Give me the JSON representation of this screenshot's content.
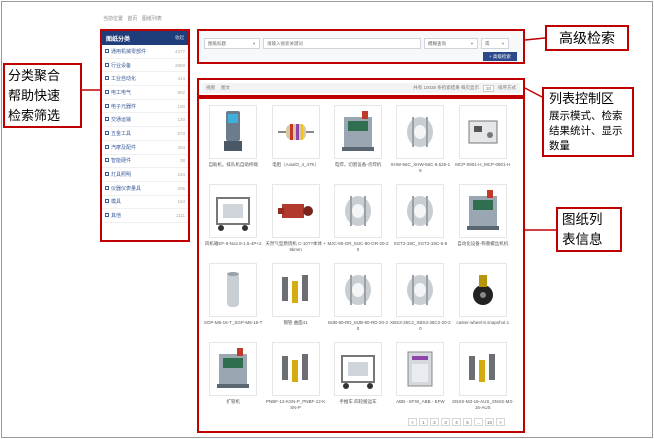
{
  "breadcrumb": [
    "当前位置",
    "首页",
    "图纸列表"
  ],
  "sidebar": {
    "title": "图纸分类",
    "more": "收起",
    "items": [
      {
        "label": "通用机械零部件",
        "count": "4377"
      },
      {
        "label": "行业设备",
        "count": "2860"
      },
      {
        "label": "工业自动化",
        "count": "414"
      },
      {
        "label": "电工电气",
        "count": "902"
      },
      {
        "label": "电子元器件",
        "count": "150"
      },
      {
        "label": "交通运输",
        "count": "120"
      },
      {
        "label": "五金工具",
        "count": "673"
      },
      {
        "label": "汽摩及配件",
        "count": "304"
      },
      {
        "label": "智能硬件",
        "count": "38"
      },
      {
        "label": "灯具照明",
        "count": "234"
      },
      {
        "label": "仪器仪表量具",
        "count": "206"
      },
      {
        "label": "模具",
        "count": "164"
      },
      {
        "label": "其他",
        "count": "1111"
      }
    ]
  },
  "search": {
    "field_select": "图纸标题",
    "placeholder": "请输入搜索关键词",
    "match_select": "模糊查询",
    "logic_select": "或",
    "button": "+ 高级检索"
  },
  "list_control": {
    "view_label": "视图",
    "view_mode": "图文",
    "stats": "共有 10038 条检索结果 每页显示",
    "page_size": "20",
    "sort": "排序方式"
  },
  "cards": [
    {
      "caption": "自助机，排队机自助终端",
      "icon": "kiosk"
    },
    {
      "caption": "电阻（AxialO_4_47K）",
      "icon": "resistor"
    },
    {
      "caption": "电焊，切割设备-点焊机",
      "icon": "machine"
    },
    {
      "caption": "XHW-56C_XHW-56C-9.525-18",
      "icon": "coupling"
    },
    {
      "caption": "MCP-0901-H_MCP-0901-H",
      "icon": "block"
    },
    {
      "caption": "风机箱EF-II-No2.8-1.5-4P+2",
      "icon": "frame"
    },
    {
      "caption": "天然气型燃烧机 C-10??本体 +6kmm",
      "icon": "burner"
    },
    {
      "caption": "MJC-80-GR_MJC-80-GR-20-20",
      "icon": "coupling"
    },
    {
      "caption": "XGT2-19C_XGT2-19C-5-8",
      "icon": "coupling"
    },
    {
      "caption": "自动化设备-称重螺丝机机",
      "icon": "machine"
    },
    {
      "caption": "SGP-M6-16-T_SGP-M6-16-T",
      "icon": "cylinder"
    },
    {
      "caption": "钢管 曲面41",
      "icon": "pins"
    },
    {
      "caption": "MJB-80-RD_MJB-80-RD-20-20",
      "icon": "coupling"
    },
    {
      "caption": "XBS3-35C2_XBS3-35C2-20-20",
      "icon": "coupling"
    },
    {
      "caption": "caster-wheel-5.snapshot.1",
      "icon": "wheel"
    },
    {
      "caption": "扩管机",
      "icon": "machine"
    },
    {
      "caption": "PNBF-12-KSN-P_PNBF-12-KSN-P",
      "icon": "pins"
    },
    {
      "caption": "手推车 四轮搬运车",
      "icon": "frame"
    },
    {
      "caption": "ABB - EFW_ABB - EFW",
      "icon": "cabinet"
    },
    {
      "caption": "SNSS-M3-16-AUS_SNSS-M3-16-AUS",
      "icon": "pins"
    }
  ],
  "pagination": [
    "<",
    "1",
    "2",
    "3",
    "4",
    "5",
    "...",
    "10",
    ">"
  ],
  "annotations": {
    "left": "分类聚合\n帮助快速\n检索筛选",
    "advanced": "高级检索",
    "list_control_title": "列表控制区",
    "list_control_desc": "展示模式、检索结果统计、显示数量",
    "grid": "图纸列\n表信息"
  },
  "colors": {
    "annotation_border": "#c00000",
    "nav_blue": "#1f3d7a",
    "button_blue": "#2b4a8c"
  }
}
